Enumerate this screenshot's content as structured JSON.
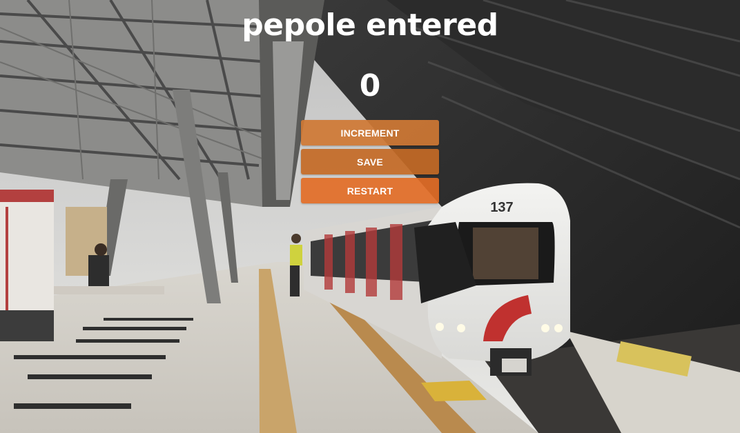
{
  "counter": {
    "title": "pepole entered",
    "count": "0"
  },
  "buttons": {
    "increment_label": "INCREMENT",
    "save_label": "SAVE",
    "restart_label": "RESTART"
  },
  "colors": {
    "increment_bg": "#cf7834",
    "save_bg": "#c46a26",
    "restart_bg": "#e26c26",
    "text": "#ffffff"
  },
  "background": {
    "train_number": "137"
  }
}
